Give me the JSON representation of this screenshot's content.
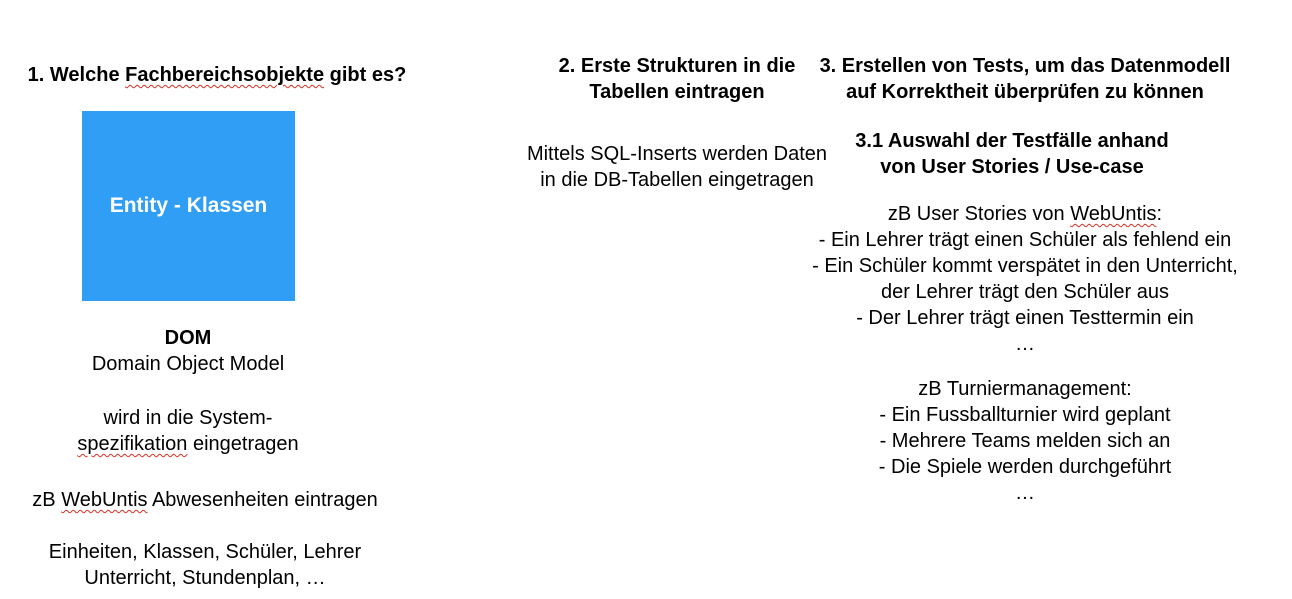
{
  "colors": {
    "entity_box": "#2f9ef4",
    "spellcheck_underline": "#d93025"
  },
  "column1": {
    "heading_prefix": "1. Welche ",
    "heading_flagged": "Fachbereichsobjekte",
    "heading_suffix": " gibt es?",
    "entity_box_label": "Entity - Klassen",
    "dom_title": "DOM",
    "dom_subtitle": "Domain Object Model",
    "spec_line1": "wird in die System-",
    "spec_line2_flagged": "spezifikation",
    "spec_line2_rest": " eingetragen",
    "example_prefix": "zB ",
    "example_flagged": "WebUntis",
    "example_rest": " Abwesenheiten eintragen",
    "entities_line1": "Einheiten, Klassen, Schüler, Lehrer",
    "entities_line2": "Unterricht, Stundenplan, …"
  },
  "column2": {
    "heading_line1": "2. Erste Strukturen in die",
    "heading_line2": "Tabellen eintragen",
    "text_line1": "Mittels SQL-Inserts werden Daten",
    "text_line2": "in die DB-Tabellen eingetragen"
  },
  "column3": {
    "heading_line1": "3. Erstellen von Tests, um das Datenmodell",
    "heading_line2": "auf Korrektheit überprüfen zu können",
    "sub_line1": "3.1 Auswahl der Testfälle anhand",
    "sub_line2": "von User Stories / Use-case",
    "webuntis_intro_prefix": "zB User Stories von ",
    "webuntis_intro_flagged": "WebUntis",
    "webuntis_intro_suffix": ":",
    "webuntis_items": [
      "- Ein Lehrer trägt einen Schüler als fehlend ein",
      "- Ein Schüler kommt verspätet in den Unterricht,",
      "der Lehrer trägt den Schüler aus",
      "- Der Lehrer trägt einen Testtermin ein",
      "…"
    ],
    "turnier_intro": "zB Turniermanagement:",
    "turnier_items": [
      "- Ein Fussballturnier wird geplant",
      "- Mehrere Teams melden sich an",
      "-  Die Spiele werden durchgeführt",
      "…"
    ]
  }
}
